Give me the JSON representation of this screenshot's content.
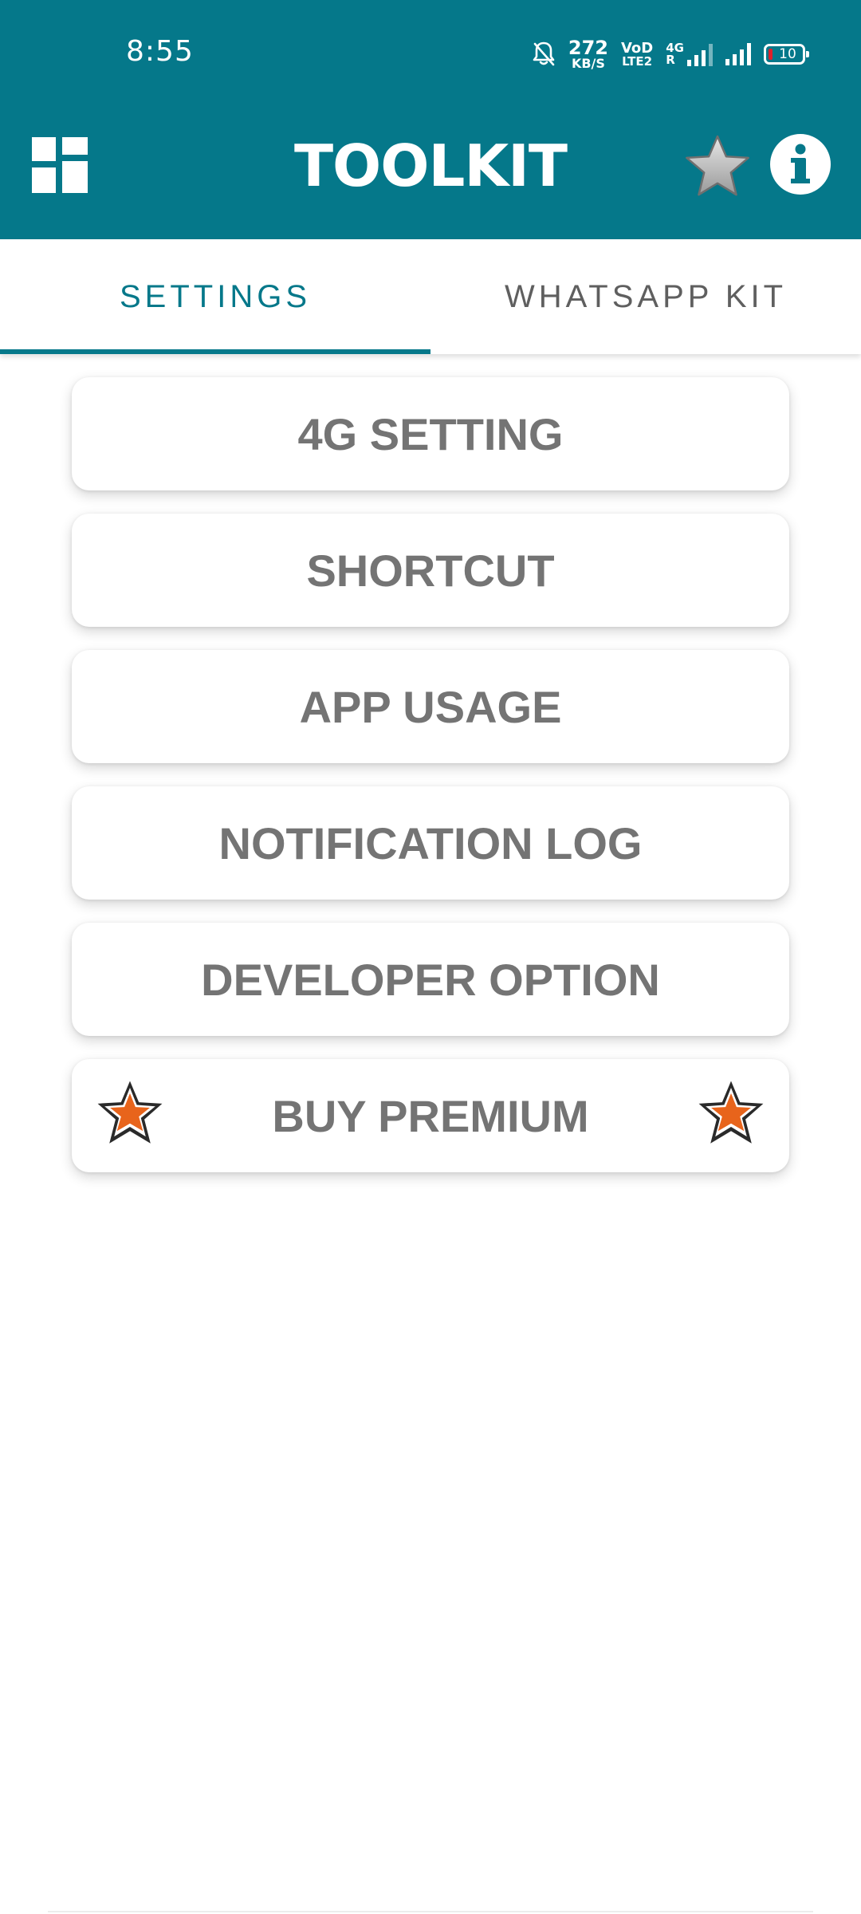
{
  "status_bar": {
    "time": "8:55",
    "speed_value": "272",
    "speed_unit": "KB/S",
    "volte_top": "VoD",
    "volte_bottom": "LTE2",
    "net_type": "4G",
    "net_sub": "R",
    "battery_level": "10"
  },
  "header": {
    "title": "TOOLKIT",
    "icons": {
      "left": "dashboard-grid-icon",
      "favorite": "star-icon",
      "info": "info-icon"
    }
  },
  "tabs": [
    {
      "label": "SETTINGS",
      "active": true
    },
    {
      "label": "WHATSAPP KIT",
      "active": false
    }
  ],
  "menu": {
    "items": [
      "4G SETTING",
      "SHORTCUT",
      "APP USAGE",
      "NOTIFICATION LOG",
      "DEVELOPER OPTION"
    ],
    "premium_label": "BUY PREMIUM"
  },
  "colors": {
    "primary": "#05788a",
    "button_text": "#747474",
    "tab_inactive": "#5f5f5f",
    "premium_star": "#e8641b"
  }
}
